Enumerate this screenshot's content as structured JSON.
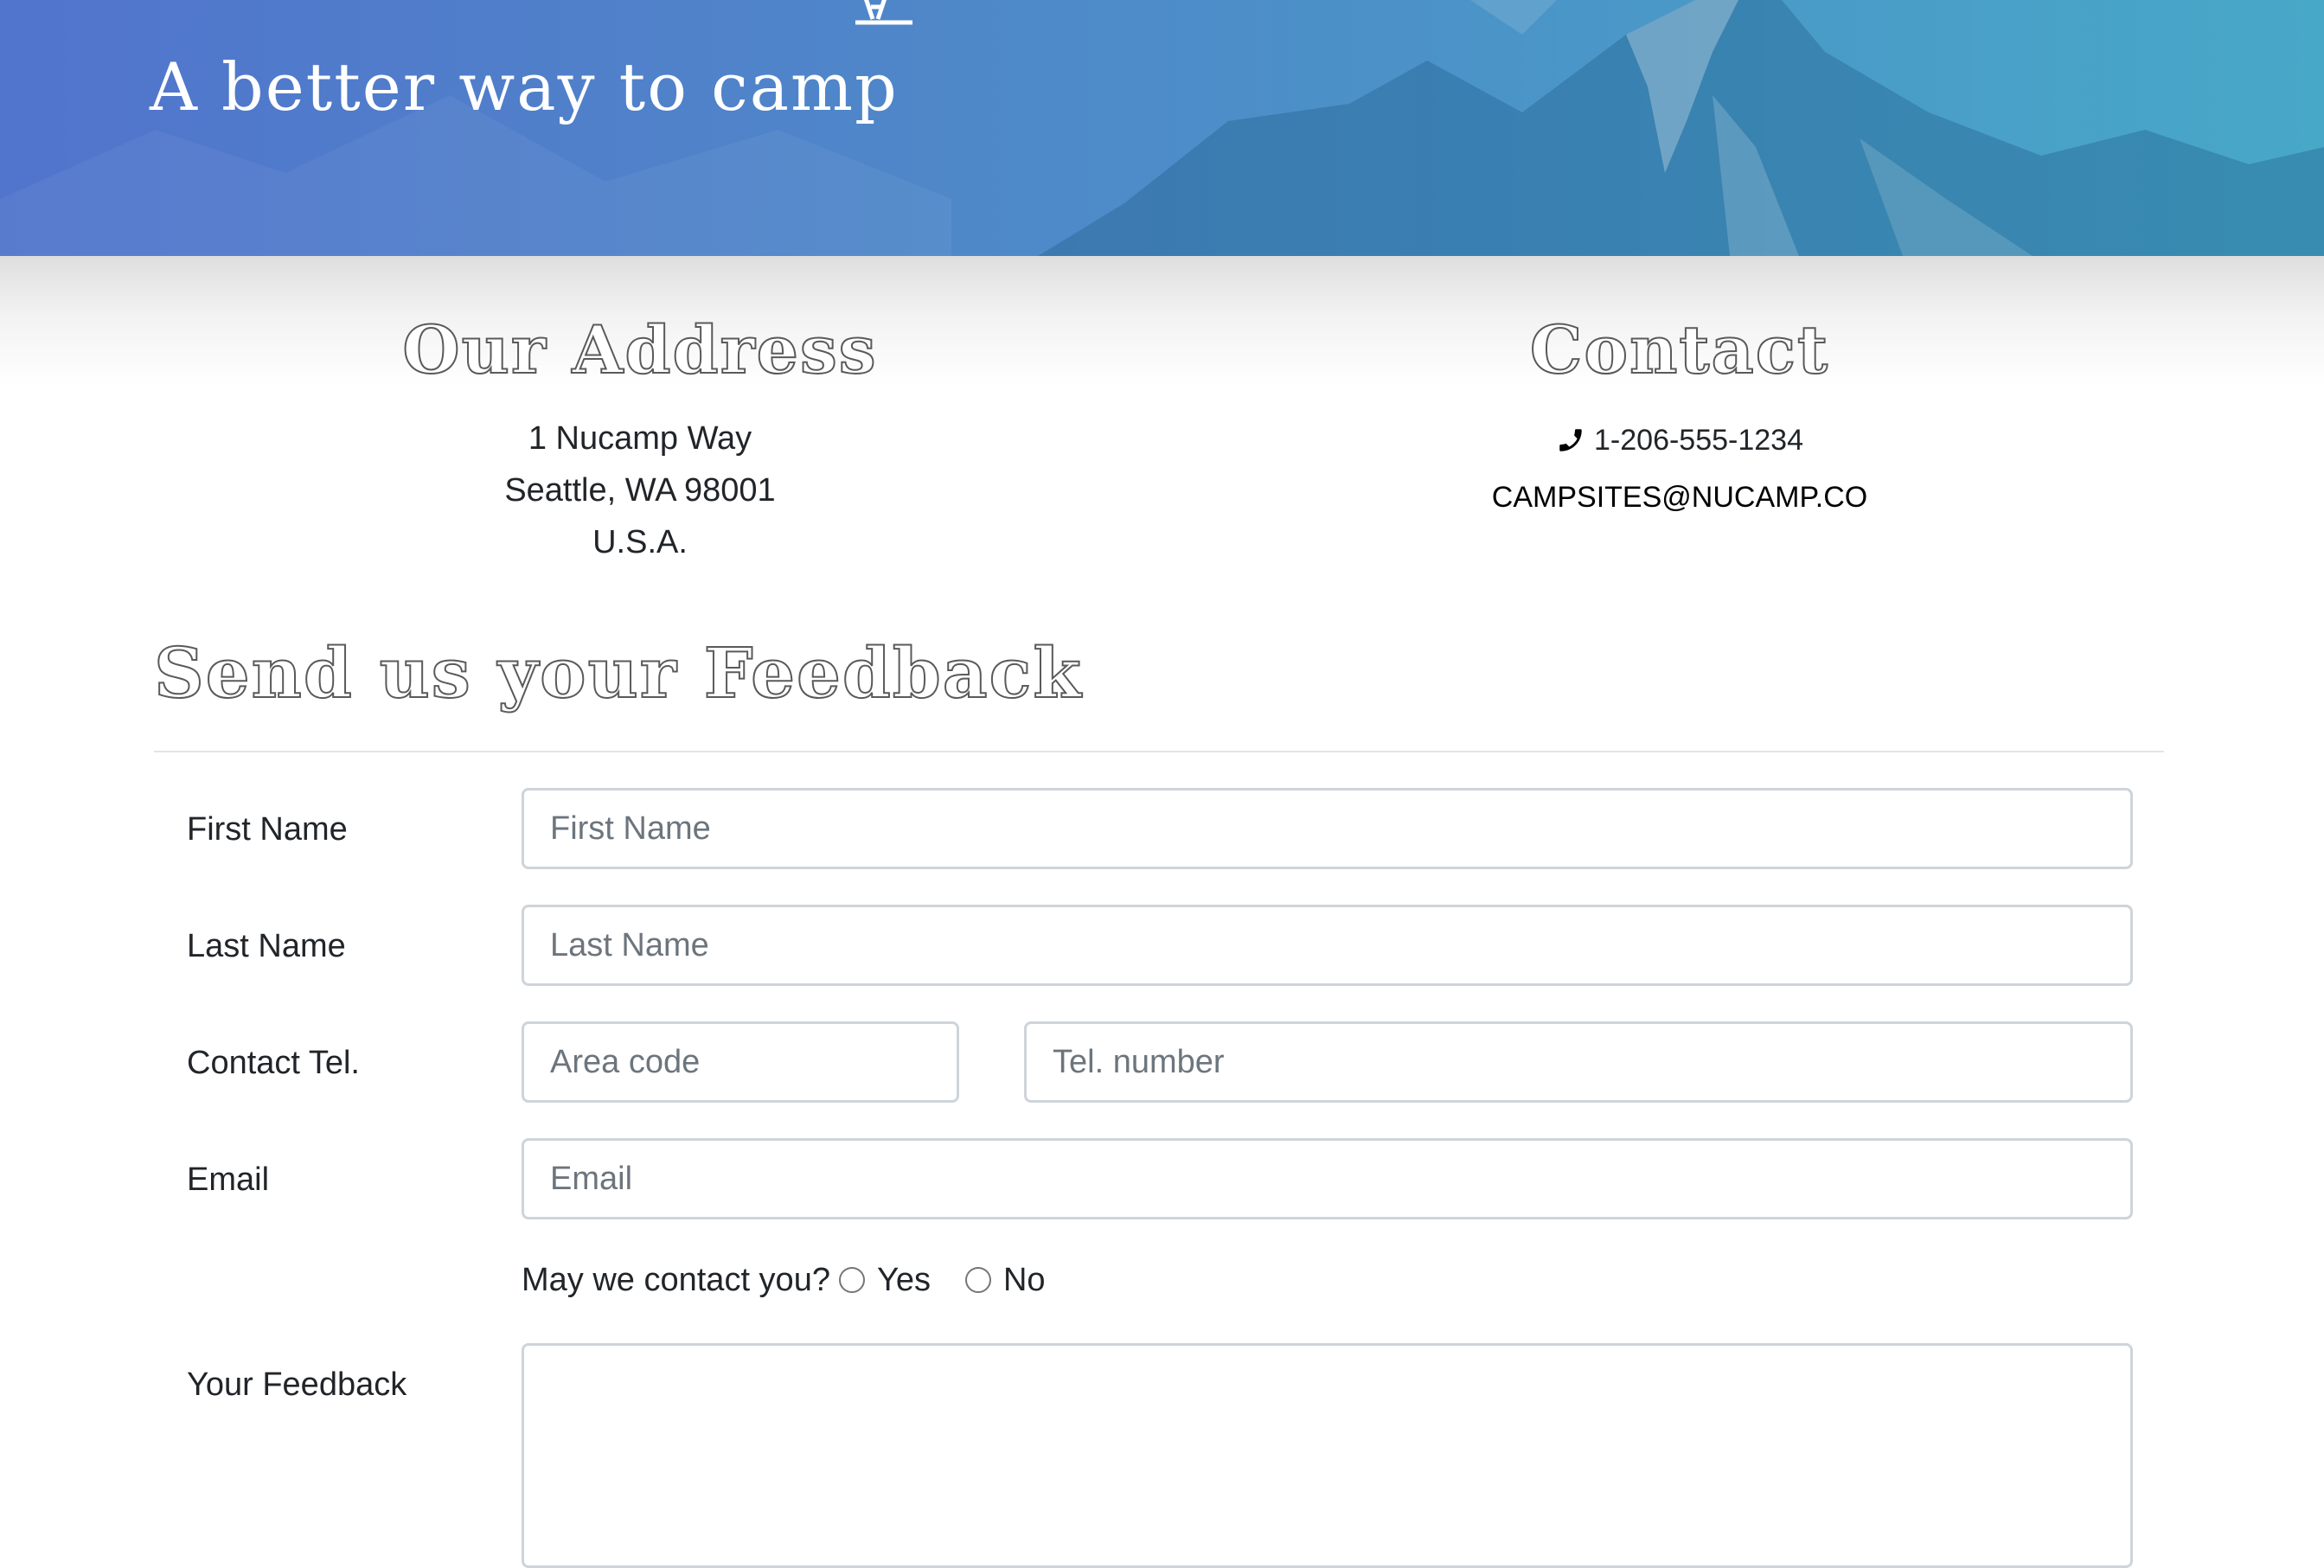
{
  "header": {
    "tagline": "A better way to camp"
  },
  "address": {
    "heading": "Our Address",
    "lines": [
      "1 Nucamp Way",
      "Seattle, WA 98001",
      "U.S.A."
    ]
  },
  "contact": {
    "heading": "Contact",
    "phone": "1-206-555-1234",
    "email": "campsites@nucamp.co"
  },
  "feedback": {
    "heading": "Send us your Feedback",
    "first_name": {
      "label": "First Name",
      "placeholder": "First Name",
      "value": ""
    },
    "last_name": {
      "label": "Last Name",
      "placeholder": "Last Name",
      "value": ""
    },
    "contact_tel": {
      "label": "Contact Tel.",
      "area_placeholder": "Area code",
      "number_placeholder": "Tel. number"
    },
    "email": {
      "label": "Email",
      "placeholder": "Email",
      "value": ""
    },
    "may_contact": {
      "question": "May we contact you?",
      "options": [
        "Yes",
        "No"
      ],
      "selected": null
    },
    "your_feedback": {
      "label": "Your Feedback",
      "value": ""
    }
  },
  "colors": {
    "banner_left": "#5174cc",
    "banner_right": "#48a8c8",
    "input_border": "#ced4da",
    "placeholder": "#6c757d",
    "text": "#212529"
  }
}
